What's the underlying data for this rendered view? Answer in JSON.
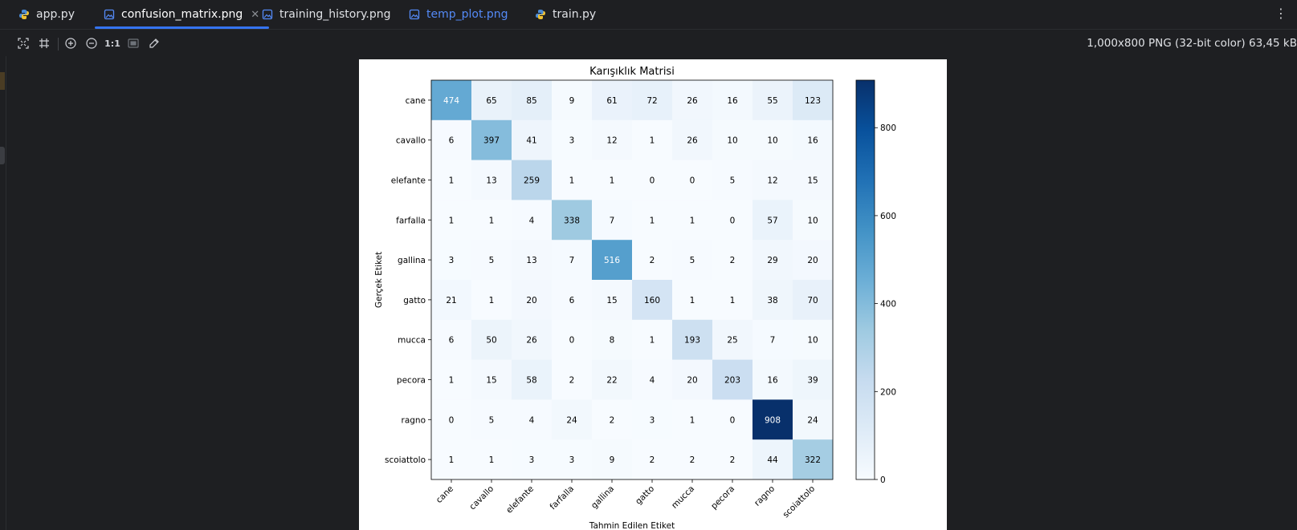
{
  "tabs": [
    {
      "label": "app.py",
      "icon": "python-icon",
      "state": "normal"
    },
    {
      "label": "confusion_matrix.png",
      "icon": "image-icon",
      "state": "active"
    },
    {
      "label": "training_history.png",
      "icon": "image-icon",
      "state": "normal"
    },
    {
      "label": "temp_plot.png",
      "icon": "image-icon",
      "state": "link"
    },
    {
      "label": "train.py",
      "icon": "python-icon",
      "state": "normal"
    }
  ],
  "toolbar": {
    "actual_size_label": "1:1",
    "icons": [
      "fit-to-screen-icon",
      "grid-icon",
      "zoom-in-icon",
      "zoom-out-icon",
      "actual-size-icon",
      "background-icon",
      "color-picker-icon"
    ]
  },
  "image_info": "1,000x800 PNG (32-bit color) 63,45 kB",
  "colors": {
    "accent": "#3574f0",
    "link": "#548af7",
    "background": "#1e1f22"
  },
  "chart_data": {
    "type": "heatmap",
    "title": "Karışıklık Matrisi",
    "xlabel": "Tahmin Edilen Etiket",
    "ylabel": "Gerçek Etiket",
    "categories": [
      "cane",
      "cavallo",
      "elefante",
      "farfalla",
      "gallina",
      "gatto",
      "mucca",
      "pecora",
      "ragno",
      "scoiattolo"
    ],
    "matrix": [
      [
        474,
        65,
        85,
        9,
        61,
        72,
        26,
        16,
        55,
        123
      ],
      [
        6,
        397,
        41,
        3,
        12,
        1,
        26,
        10,
        10,
        16
      ],
      [
        1,
        13,
        259,
        1,
        1,
        0,
        0,
        5,
        12,
        15
      ],
      [
        1,
        1,
        4,
        338,
        7,
        1,
        1,
        0,
        57,
        10
      ],
      [
        3,
        5,
        13,
        7,
        516,
        2,
        5,
        2,
        29,
        20
      ],
      [
        21,
        1,
        20,
        6,
        15,
        160,
        1,
        1,
        38,
        70
      ],
      [
        6,
        50,
        26,
        0,
        8,
        1,
        193,
        25,
        7,
        10
      ],
      [
        1,
        15,
        58,
        2,
        22,
        4,
        20,
        203,
        16,
        39
      ],
      [
        0,
        5,
        4,
        24,
        2,
        3,
        1,
        0,
        908,
        24
      ],
      [
        1,
        1,
        3,
        3,
        9,
        2,
        2,
        2,
        44,
        322
      ]
    ],
    "colormap": "Blues",
    "vmin": 0,
    "vmax": 908,
    "colorbar_ticks": [
      0,
      200,
      400,
      600,
      800
    ]
  }
}
